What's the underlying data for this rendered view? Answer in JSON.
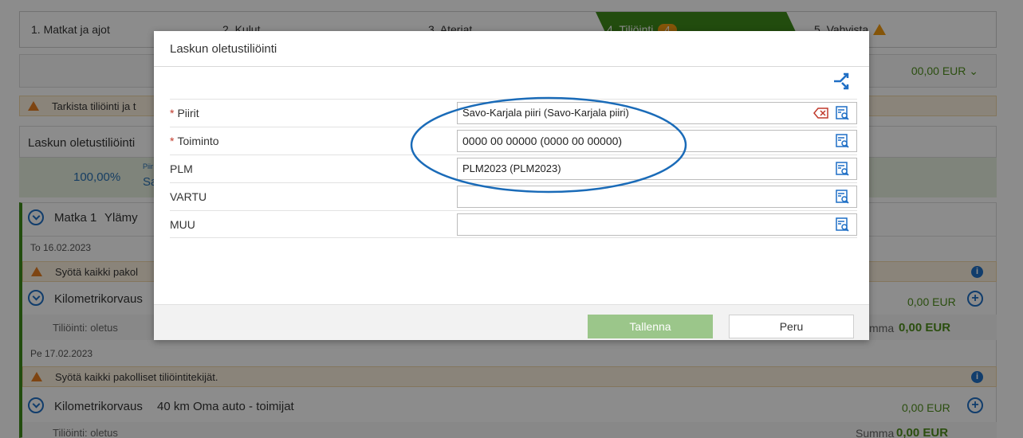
{
  "steps": [
    {
      "label": "1. Matkat ja ajot"
    },
    {
      "label": "2. Kulut"
    },
    {
      "label": "3. Ateriat"
    },
    {
      "label": "4. Tiliöinti",
      "badge": "4"
    },
    {
      "label": "5. Vahvista"
    }
  ],
  "top_amount": "00,00 EUR ⌄",
  "warning_top": "Tarkista tiliöinti ja t",
  "default_account_panel": {
    "title": "Laskun oletustiliöinti",
    "percent": "100,00%",
    "piiri_short": "Piir",
    "value_short": "Sa"
  },
  "trip": {
    "title": "Matka 1",
    "subtitle": "Ylämy"
  },
  "day1": {
    "date": "To 16.02.2023",
    "warning": "Syötä kaikki pakol",
    "expense": "Kilometrikorvaus",
    "amount": "0,00 EUR",
    "posting": "Tiliöinti: oletus",
    "sum_label": "mma",
    "sum_value": "0,00 EUR"
  },
  "day2": {
    "date": "Pe 17.02.2023",
    "warning": "Syötä kaikki pakolliset tiliöintitekijät.",
    "expense_label": "Kilometrikorvaus",
    "expense_detail": "40 km Oma auto - toimijat",
    "amount": "0,00 EUR",
    "posting": "Tiliöinti: oletus",
    "sum_label": "Summa",
    "sum_value": "0,00 EUR"
  },
  "info_mark": "i",
  "plus_mark": "+",
  "modal": {
    "title": "Laskun oletustiliöinti",
    "required_mark": "*",
    "fields": [
      {
        "label": "Piirit",
        "required": true,
        "value": "Savo-Karjala piiri (Savo-Karjala piiri)"
      },
      {
        "label": "Toiminto",
        "required": true,
        "value": "0000 00 00000 (0000 00 00000)"
      },
      {
        "label": "PLM",
        "required": false,
        "value": "PLM2023 (PLM2023)"
      },
      {
        "label": "VARTU",
        "required": false,
        "value": ""
      },
      {
        "label": "MUU",
        "required": false,
        "value": ""
      }
    ],
    "save_label": "Tallenna",
    "cancel_label": "Peru"
  },
  "colors": {
    "accent": "#1f6fc5",
    "green": "#3f8a1a",
    "warning": "#f39c12",
    "annotation": "#1a6bb8"
  }
}
